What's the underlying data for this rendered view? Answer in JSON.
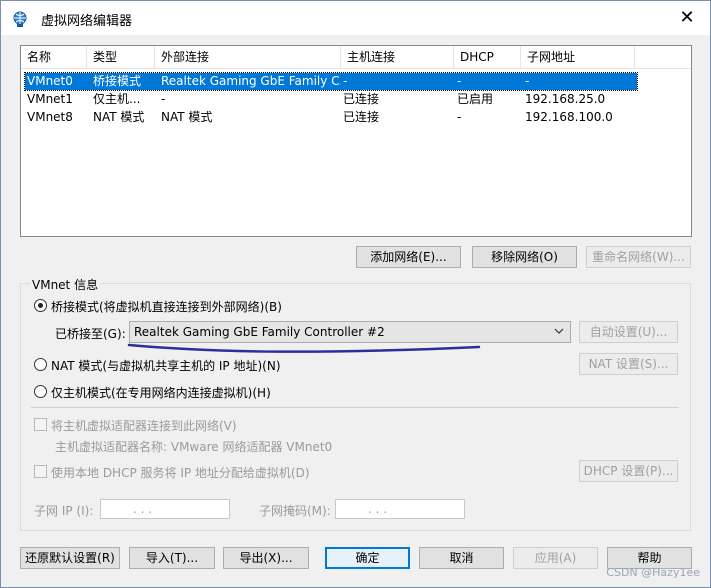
{
  "window": {
    "title": "虚拟网络编辑器",
    "close_symbol": "✕"
  },
  "network_list": {
    "columns": [
      "名称",
      "类型",
      "外部连接",
      "主机连接",
      "DHCP",
      "子网地址"
    ],
    "rows": [
      {
        "name": "VMnet0",
        "type": "桥接模式",
        "external": "Realtek Gaming GbE Family C...",
        "host": "-",
        "dhcp": "-",
        "subnet": "-",
        "selected": true
      },
      {
        "name": "VMnet1",
        "type": "仅主机...",
        "external": "-",
        "host": "已连接",
        "dhcp": "已启用",
        "subnet": "192.168.25.0",
        "selected": false
      },
      {
        "name": "VMnet8",
        "type": "NAT 模式",
        "external": "NAT 模式",
        "host": "已连接",
        "dhcp": "-",
        "subnet": "192.168.100.0",
        "selected": false
      }
    ]
  },
  "list_buttons": {
    "add": "添加网络(E)...",
    "remove": "移除网络(O)",
    "rename": "重命名网络(W)..."
  },
  "vmnet_info": {
    "group_label": "VMnet 信息",
    "bridge_radio": "桥接模式(将虚拟机直接连接到外部网络)(B)",
    "bridged_to_label": "已桥接至(G):",
    "bridged_to_value": "Realtek Gaming GbE Family Controller #2",
    "auto_settings": "自动设置(U)...",
    "nat_radio": "NAT 模式(与虚拟机共享主机的 IP 地址)(N)",
    "nat_settings": "NAT 设置(S)...",
    "hostonly_radio": "仅主机模式(在专用网络内连接虚拟机)(H)",
    "connect_adapter_check": "将主机虚拟适配器连接到此网络(V)",
    "adapter_name": "主机虚拟适配器名称: VMware 网络适配器 VMnet0",
    "dhcp_check": "使用本地 DHCP 服务将 IP 地址分配给虚拟机(D)",
    "dhcp_settings": "DHCP 设置(P)...",
    "subnet_ip_label": "子网 IP (I):",
    "subnet_mask_label": "子网掩码(M):",
    "ip_dots": ".        .        ."
  },
  "footer_buttons": {
    "restore": "还原默认设置(R)",
    "import": "导入(T)...",
    "export": "导出(X)...",
    "ok": "确定",
    "cancel": "取消",
    "apply": "应用(A)",
    "help": "帮助"
  },
  "watermark": "CSDN @Hazy1ee",
  "colors": {
    "selection": "#0078d7",
    "annotation_underline": "#2b2f9e",
    "desktop": "#3a66b8"
  }
}
